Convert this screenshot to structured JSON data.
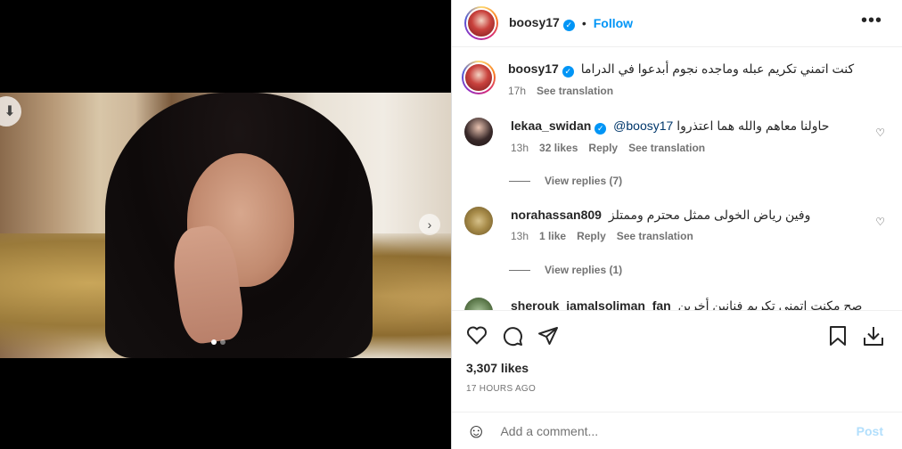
{
  "post": {
    "username": "boosy17",
    "separator": "•",
    "follow_label": "Follow",
    "more_label": "•••",
    "verified_mark": "✓",
    "caption": "كنت اتمني تكريم عبله وماجده نجوم أبدعوا في الدراما",
    "caption_time": "17h",
    "see_translation": "See translation"
  },
  "comments": [
    {
      "username": "lekaa_swidan",
      "verified": true,
      "mention": "@boosy17",
      "text": "حاولنا معاهم والله هما اعتذروا",
      "time": "13h",
      "likes": "32 likes",
      "reply": "Reply",
      "see_translation": "See translation",
      "view_replies": "View replies (7)"
    },
    {
      "username": "norahassan809",
      "verified": false,
      "text": "وفين رياض الخولى ممثل محترم وممتلز",
      "time": "13h",
      "likes": "1 like",
      "reply": "Reply",
      "see_translation": "See translation",
      "view_replies": "View replies (1)"
    },
    {
      "username": "sherouk_jamalsoliman_fan",
      "text": "صح مكنت اتمني تكريم فنانين أخرين"
    }
  ],
  "actions": {
    "like_icon": "heart-icon",
    "comment_icon": "comment-icon",
    "share_icon": "share-icon",
    "save_icon": "bookmark-icon",
    "download_icon": "download-icon"
  },
  "likes_text": "3,307 likes",
  "posted_time": "17 HOURS AGO",
  "comment_input": {
    "placeholder": "Add a comment...",
    "post_label": "Post"
  },
  "carousel": {
    "slide_count": 2,
    "active_index": 0
  }
}
